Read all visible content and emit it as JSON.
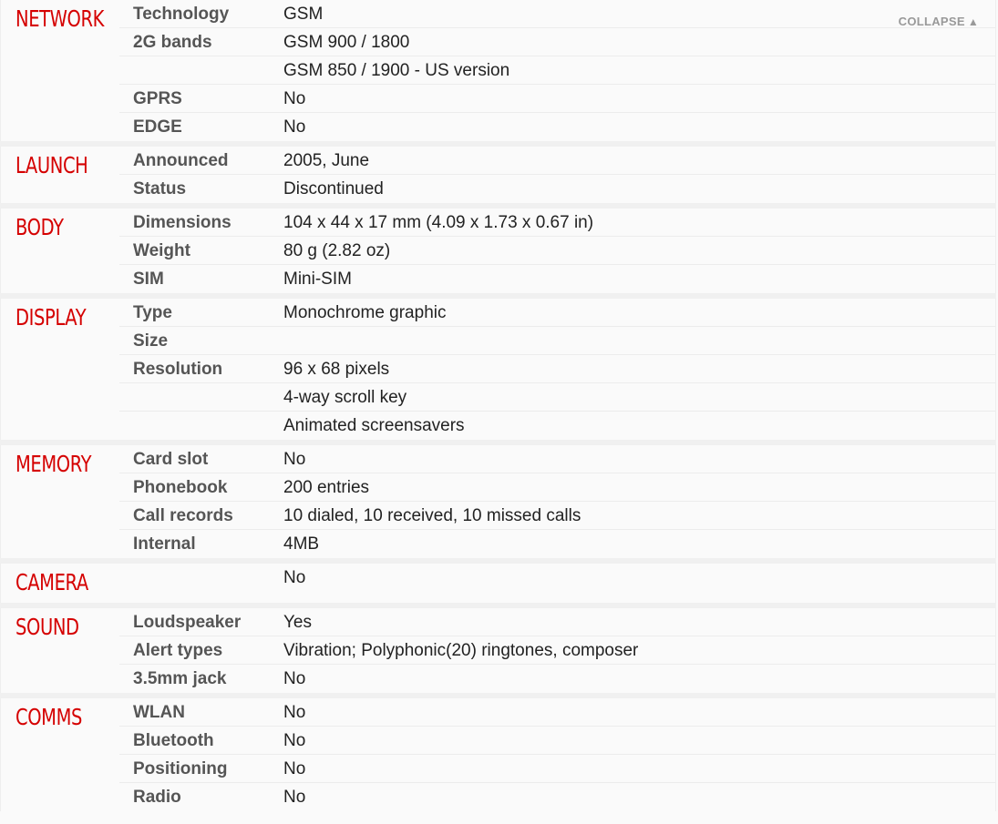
{
  "collapse": {
    "label": "COLLAPSE",
    "icon": "▲"
  },
  "sections": [
    {
      "title": "NETWORK",
      "rows": [
        {
          "label": "Technology",
          "value": "GSM"
        },
        {
          "label": "2G bands",
          "value": "GSM 900 / 1800"
        },
        {
          "label": "",
          "value": "GSM 850 / 1900 - US version"
        },
        {
          "label": "GPRS",
          "value": "No"
        },
        {
          "label": "EDGE",
          "value": "No"
        }
      ]
    },
    {
      "title": "LAUNCH",
      "rows": [
        {
          "label": "Announced",
          "value": "2005, June"
        },
        {
          "label": "Status",
          "value": "Discontinued"
        }
      ]
    },
    {
      "title": "BODY",
      "rows": [
        {
          "label": "Dimensions",
          "value": "104 x 44 x 17 mm (4.09 x 1.73 x 0.67 in)"
        },
        {
          "label": "Weight",
          "value": "80 g (2.82 oz)"
        },
        {
          "label": "SIM",
          "value": "Mini-SIM"
        }
      ]
    },
    {
      "title": "DISPLAY",
      "rows": [
        {
          "label": "Type",
          "value": "Monochrome graphic"
        },
        {
          "label": "Size",
          "value": ""
        },
        {
          "label": "Resolution",
          "value": "96 x 68 pixels"
        },
        {
          "label": "",
          "value": "4-way scroll key"
        },
        {
          "label": "",
          "value": "Animated screensavers"
        }
      ]
    },
    {
      "title": "MEMORY",
      "rows": [
        {
          "label": "Card slot",
          "value": "No"
        },
        {
          "label": "Phonebook",
          "value": "200 entries"
        },
        {
          "label": "Call records",
          "value": "10 dialed, 10 received, 10 missed calls"
        },
        {
          "label": "Internal",
          "value": "4MB"
        }
      ]
    },
    {
      "title": "CAMERA",
      "rows": [
        {
          "label": "",
          "value": "No"
        }
      ]
    },
    {
      "title": "SOUND",
      "rows": [
        {
          "label": "Loudspeaker",
          "value": "Yes"
        },
        {
          "label": "Alert types",
          "value": "Vibration; Polyphonic(20) ringtones, composer"
        },
        {
          "label": "3.5mm jack",
          "value": "No"
        }
      ]
    },
    {
      "title": "COMMS",
      "rows": [
        {
          "label": "WLAN",
          "value": "No"
        },
        {
          "label": "Bluetooth",
          "value": "No"
        },
        {
          "label": "Positioning",
          "value": "No"
        },
        {
          "label": "Radio",
          "value": "No"
        }
      ]
    }
  ]
}
